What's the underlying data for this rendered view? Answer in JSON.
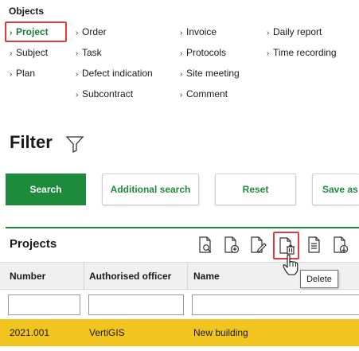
{
  "objects": {
    "title": "Objects",
    "items": [
      {
        "label": "Project",
        "active": true
      },
      {
        "label": "Subject"
      },
      {
        "label": "Plan"
      },
      {
        "label": "Order"
      },
      {
        "label": "Task"
      },
      {
        "label": "Defect indication"
      },
      {
        "label": "Subcontract"
      },
      {
        "label": "Invoice"
      },
      {
        "label": "Protocols"
      },
      {
        "label": "Site meeting"
      },
      {
        "label": "Comment"
      },
      {
        "label": "Daily report"
      },
      {
        "label": "Time recording"
      }
    ]
  },
  "filter": {
    "title": "Filter",
    "icon": "funnel-icon",
    "buttons": {
      "search": "Search",
      "additional_search": "Additional search",
      "reset": "Reset",
      "save_as": "Save as"
    }
  },
  "projects": {
    "title": "Projects",
    "toolbar": [
      {
        "icon": "document-search-icon"
      },
      {
        "icon": "document-add-icon"
      },
      {
        "icon": "document-edit-icon"
      },
      {
        "icon": "document-delete-icon",
        "highlighted": true
      },
      {
        "icon": "document-lines-icon"
      },
      {
        "icon": "document-download-icon"
      }
    ],
    "columns": [
      "Number",
      "Authorised officer",
      "Name"
    ],
    "rows": [
      {
        "number": "2021.001",
        "authorised_officer": "VertiGIS",
        "name": "New building",
        "selected": true
      }
    ],
    "tooltip": "Delete"
  },
  "colors": {
    "accent": "#1e8a3c",
    "active_link": "#1a7a33",
    "highlight_border": "#e03c3c",
    "selected_row": "#f2c420"
  }
}
